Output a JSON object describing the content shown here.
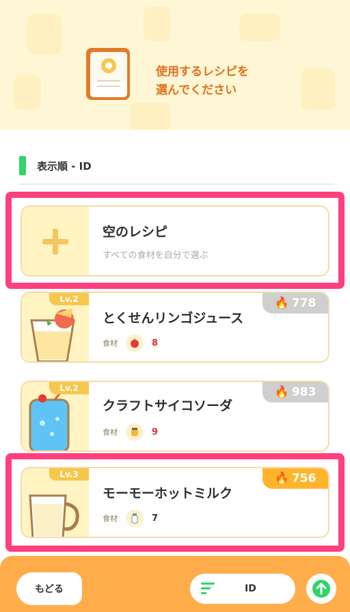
{
  "header": {
    "title_line1": "使用するレシピを",
    "title_line2": "選んでください"
  },
  "sort": {
    "label": "表示順 - ID"
  },
  "empty_recipe": {
    "title": "空のレシピ",
    "subtitle": "すべての食材を自分で選ぶ"
  },
  "recipes": [
    {
      "level": "Lv.2",
      "name": "とくせんリンゴジュース",
      "energy": "778",
      "ingredient_label": "食材",
      "ingredient_icon": "apple-icon",
      "ingredient_count": "8",
      "selectable": false
    },
    {
      "level": "Lv.2",
      "name": "クラフトサイコソーダ",
      "energy": "983",
      "ingredient_label": "食材",
      "ingredient_icon": "honey-icon",
      "ingredient_count": "9",
      "selectable": false
    },
    {
      "level": "Lv.3",
      "name": "モーモーホットミルク",
      "energy": "756",
      "ingredient_label": "食材",
      "ingredient_icon": "milk-icon",
      "ingredient_count": "7",
      "selectable": true
    }
  ],
  "footer": {
    "back_label": "もどる",
    "sort_value": "ID"
  },
  "colors": {
    "accent_orange": "#ffad4a",
    "highlight_pink": "#ff3f7e",
    "sort_green": "#2fd46a",
    "unavailable_count_red": "#e0302a"
  }
}
